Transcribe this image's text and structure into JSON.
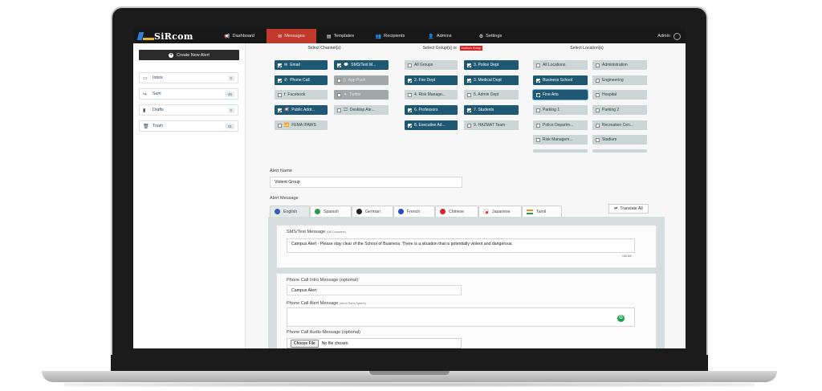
{
  "app": {
    "logo": "SiRcom",
    "user": "Admin"
  },
  "nav": [
    {
      "label": "Dashboard",
      "icon": "megaphone-icon",
      "glyph": "📢"
    },
    {
      "label": "Messages",
      "icon": "chat-bubble-icon",
      "glyph": "✉",
      "active": true
    },
    {
      "label": "Templates",
      "icon": "template-icon",
      "glyph": "▤"
    },
    {
      "label": "Recipients",
      "icon": "users-icon",
      "glyph": "👥"
    },
    {
      "label": "Admins",
      "icon": "user-icon",
      "glyph": "👤"
    },
    {
      "label": "Settings",
      "icon": "gear-icon",
      "glyph": "⚙"
    }
  ],
  "sidebar": {
    "create_label": "Create New Alert",
    "folders": [
      {
        "label": "Inbox",
        "count": "0",
        "glyph": "▭"
      },
      {
        "label": "Sent",
        "count": "46",
        "glyph": "↪"
      },
      {
        "label": "Drafts",
        "count": "0",
        "glyph": "▮"
      },
      {
        "label": "Trash",
        "count": "51",
        "glyph": "🗑"
      }
    ]
  },
  "channels": {
    "heading": "Select Channel(s)",
    "items": [
      {
        "label": "Email",
        "glyph": "✉",
        "state": "on"
      },
      {
        "label": "SMS/Text M...",
        "glyph": "💬",
        "state": "on"
      },
      {
        "label": "Phone Call",
        "glyph": "✆",
        "state": "on"
      },
      {
        "label": "App Push",
        "glyph": "▯",
        "state": "dim"
      },
      {
        "label": "Facebook",
        "glyph": "f",
        "state": "off"
      },
      {
        "label": "Twitter",
        "glyph": "✦",
        "state": "dim"
      },
      {
        "label": "Public Addr...",
        "glyph": "📢",
        "state": "on"
      },
      {
        "label": "Desktop Ale...",
        "glyph": "🖵",
        "state": "off"
      },
      {
        "label": "FEMA IPAWS",
        "glyph": "📶",
        "state": "off"
      }
    ]
  },
  "groups": {
    "heading_prefix": "Select Group(s) or",
    "custom_label": "Custom Group",
    "items": [
      {
        "label": "All Groups",
        "state": "off"
      },
      {
        "label": "3. Police Dept",
        "state": "on"
      },
      {
        "label": "2. Fire Dept",
        "state": "on"
      },
      {
        "label": "3. Medical Dept",
        "state": "on"
      },
      {
        "label": "4. Risk Manage...",
        "state": "off"
      },
      {
        "label": "5. Admin Dept",
        "state": "off"
      },
      {
        "label": "6. Professors",
        "state": "on"
      },
      {
        "label": "7. Students",
        "state": "on"
      },
      {
        "label": "8. Executive Ad...",
        "state": "on"
      },
      {
        "label": "9. HAZMAT Team",
        "state": "off"
      }
    ]
  },
  "locations": {
    "heading": "Select Location(s)",
    "items": [
      {
        "label": "All Locations",
        "state": "off"
      },
      {
        "label": "Administration",
        "state": "off"
      },
      {
        "label": "Business School",
        "state": "on"
      },
      {
        "label": "Engineering",
        "state": "off"
      },
      {
        "label": "Fine Arts",
        "state": "focus"
      },
      {
        "label": "Hospital",
        "state": "off"
      },
      {
        "label": "Parking 1",
        "state": "off"
      },
      {
        "label": "Parking 2",
        "state": "off"
      },
      {
        "label": "Police Departm...",
        "state": "off"
      },
      {
        "label": "Recreation Cen...",
        "state": "off"
      },
      {
        "label": "Risk Managem...",
        "state": "off"
      },
      {
        "label": "Stadium",
        "state": "off"
      }
    ]
  },
  "alert_name": {
    "label": "Alert Name",
    "value": "Violent Group"
  },
  "alert_message": {
    "label": "Alert Message",
    "tabs": [
      {
        "label": "English",
        "flag": "us-flag-icon",
        "color": "#3b5bb5"
      },
      {
        "label": "Spanish",
        "flag": "mexico-flag-icon",
        "color": "#2a9b4a"
      },
      {
        "label": "German",
        "flag": "germany-flag-icon",
        "color": "#222222"
      },
      {
        "label": "French",
        "flag": "france-flag-icon",
        "color": "#2a4bbd"
      },
      {
        "label": "Chinese",
        "flag": "china-flag-icon",
        "color": "#d62828"
      },
      {
        "label": "Japanese",
        "flag": "japan-flag-icon",
        "color": "#d62828"
      },
      {
        "label": "Tamil",
        "flag": "india-flag-icon",
        "color": "#f08a24"
      }
    ],
    "translate_label": "Translate All"
  },
  "sms": {
    "label": "SMS/Text Message",
    "sub": "(160 Characters)",
    "value": "Campus Alert - Please stay clear of the School of Business. There is a situation that is potentially violent and dangerous.",
    "count": "124/160"
  },
  "phone_intro": {
    "label": "Phone Call Intro Message (optional)",
    "value": "Campus Alert"
  },
  "phone_alert": {
    "label": "Phone Call Alert Message",
    "sub": "(text to Text to Speech)",
    "value": ""
  },
  "phone_audio": {
    "label": "Phone Call Audio Message (optional)",
    "button": "Choose File",
    "status": "No file chosen"
  }
}
